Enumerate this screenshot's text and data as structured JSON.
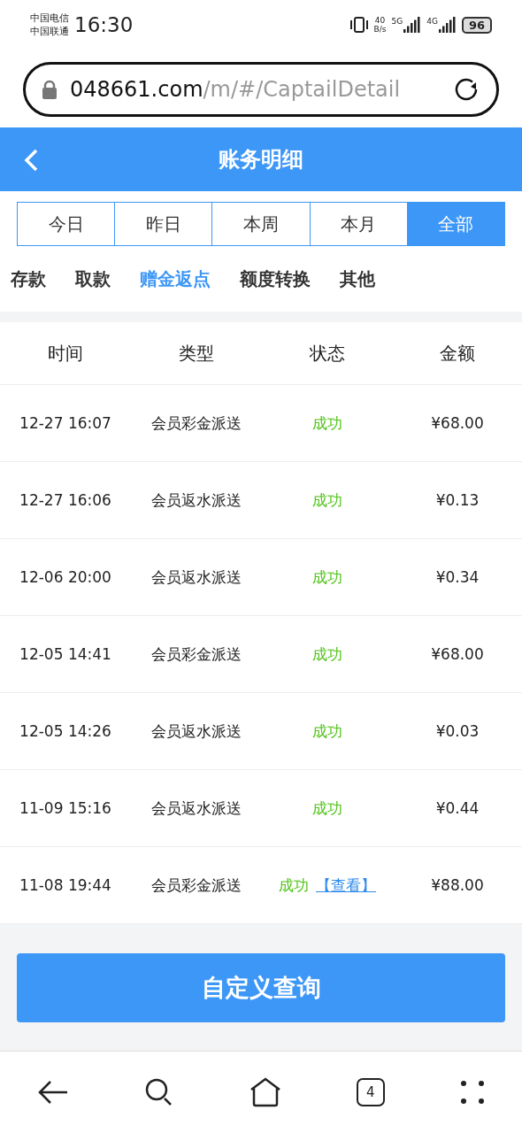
{
  "status_bar": {
    "carriers": [
      "中国电信",
      "中国联通"
    ],
    "time": "16:30",
    "speed": [
      "40",
      "B/s"
    ],
    "networks": [
      "5G",
      "4G"
    ],
    "battery": "96"
  },
  "address_bar": {
    "domain": "048661.com",
    "path": "/m/#/CaptailDetail"
  },
  "header": {
    "title": "账务明细"
  },
  "date_tabs": [
    {
      "label": "今日",
      "selected": false
    },
    {
      "label": "昨日",
      "selected": false
    },
    {
      "label": "本周",
      "selected": false
    },
    {
      "label": "本月",
      "selected": false
    },
    {
      "label": "全部",
      "selected": true
    }
  ],
  "category_tabs": [
    {
      "label": "存款",
      "selected": false
    },
    {
      "label": "取款",
      "selected": false
    },
    {
      "label": "赠金返点",
      "selected": true
    },
    {
      "label": "额度转换",
      "selected": false
    },
    {
      "label": "其他",
      "selected": false
    }
  ],
  "table": {
    "columns": [
      "时间",
      "类型",
      "状态",
      "金额"
    ],
    "rows": [
      {
        "time": "12-27 16:07",
        "type": "会员彩金派送",
        "status": "成功",
        "amount": "¥68.00"
      },
      {
        "time": "12-27 16:06",
        "type": "会员返水派送",
        "status": "成功",
        "amount": "¥0.13"
      },
      {
        "time": "12-06 20:00",
        "type": "会员返水派送",
        "status": "成功",
        "amount": "¥0.34"
      },
      {
        "time": "12-05 14:41",
        "type": "会员彩金派送",
        "status": "成功",
        "amount": "¥68.00"
      },
      {
        "time": "12-05 14:26",
        "type": "会员返水派送",
        "status": "成功",
        "amount": "¥0.03"
      },
      {
        "time": "11-09 15:16",
        "type": "会员返水派送",
        "status": "成功",
        "amount": "¥0.44"
      },
      {
        "time": "11-08 19:44",
        "type": "会员彩金派送",
        "status": "成功",
        "link": "【查看】",
        "amount": "¥88.00"
      }
    ]
  },
  "query_button": "自定义查询",
  "nav_bar": {
    "tab_count": "4"
  }
}
